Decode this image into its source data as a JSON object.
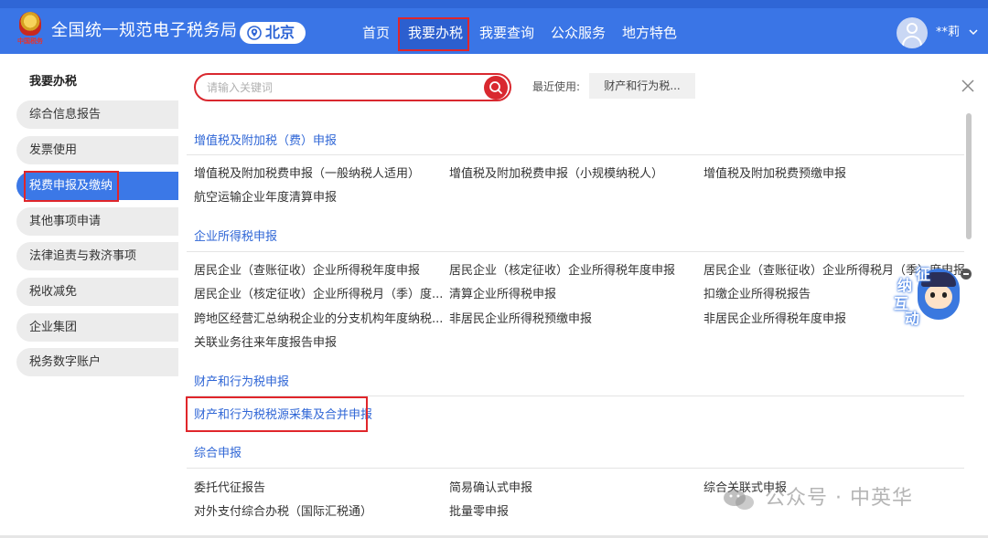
{
  "header": {
    "logo_text": "中国税务",
    "app_title": "全国统一规范电子税务局",
    "region": "北京",
    "nav": [
      "首页",
      "我要办税",
      "我要查询",
      "公众服务",
      "地方特色"
    ],
    "user_name": "**莉"
  },
  "sidebar": {
    "title": "我要办税",
    "items": [
      "综合信息报告",
      "发票使用",
      "税费申报及缴纳",
      "其他事项申请",
      "法律追责与救济事项",
      "税收减免",
      "企业集团",
      "税务数字账户"
    ],
    "active_index": 2
  },
  "search": {
    "placeholder": "请输入关键词",
    "recent_label": "最近使用:",
    "recent_item": "财产和行为税..."
  },
  "sections": [
    {
      "title": "增值税及附加税（费）申报",
      "links": [
        "增值税及附加税费申报（一般纳税人适用）",
        "增值税及附加税费申报（小规模纳税人）",
        "增值税及附加税费预缴申报",
        "航空运输企业年度清算申报"
      ]
    },
    {
      "title": "企业所得税申报",
      "links": [
        "居民企业（查账征收）企业所得税年度申报",
        "居民企业（核定征收）企业所得税年度申报",
        "居民企业（查账征收）企业所得税月（季）度申报",
        "居民企业（核定征收）企业所得税月（季）度...",
        "清算企业所得税申报",
        "扣缴企业所得税报告",
        "跨地区经营汇总纳税企业的分支机构年度纳税...",
        "非居民企业所得税预缴申报",
        "非居民企业所得税年度申报",
        "关联业务往来年度报告申报"
      ]
    },
    {
      "title": "财产和行为税申报",
      "links": [
        "财产和行为税税源采集及合并申报"
      ]
    },
    {
      "title": "综合申报",
      "links": [
        "委托代征报告",
        "简易确认式申报",
        "综合关联式申报",
        "对外支付综合办税（国际汇税通）",
        "批量零申报"
      ]
    }
  ],
  "mascot": {
    "chars": [
      "征",
      "纳",
      "互",
      "动"
    ]
  },
  "watermark": "公众号 · 中英华",
  "colors": {
    "header_blue": "#3a75e6",
    "link_blue": "#2f66d6",
    "highlight_red": "#e0262b",
    "search_red": "#d9282f"
  }
}
